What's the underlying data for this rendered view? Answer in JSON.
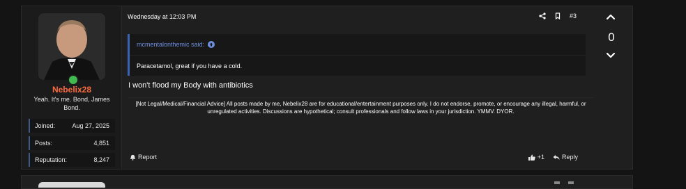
{
  "post": {
    "date": "Wednesday at 12:03 PM",
    "post_number": "#3",
    "user": {
      "name": "Nebelix28",
      "title": "Yeah. It's me. Bond, James Bond.",
      "stats": [
        {
          "label": "Joined:",
          "value": "Aug 27, 2025"
        },
        {
          "label": "Posts:",
          "value": "4,851"
        },
        {
          "label": "Reputation:",
          "value": "8,247"
        }
      ]
    },
    "quote": {
      "author": "mcmentalonthemic said:",
      "text": "Paracetamol, great if you have a cold."
    },
    "body": "I won't flood my Body with antibiotics",
    "disclaimer": "[Not Legal/Medical/Financial Advice] All posts made by me, Nebelix28 are for educational/entertainment purposes only. I do not endorse, promote, or encourage any illegal, harmful, or unregulated activities. Discussions are hypothetical; consult professionals and follow laws in your jurisdiction. YMMV. DYOR.",
    "footer": {
      "report": "Report",
      "like_count": "+1",
      "reply": "Reply"
    },
    "vote_count": "0"
  },
  "colors": {
    "username": "#ff6a3d",
    "quote_accent": "#3b63b3",
    "online": "#3fb950"
  },
  "icons": [
    "share-icon",
    "bookmark-icon",
    "arrow-up-circle-icon",
    "bell-icon",
    "thumbs-up-icon",
    "reply-icon",
    "chevron-up-icon",
    "chevron-down-icon"
  ]
}
